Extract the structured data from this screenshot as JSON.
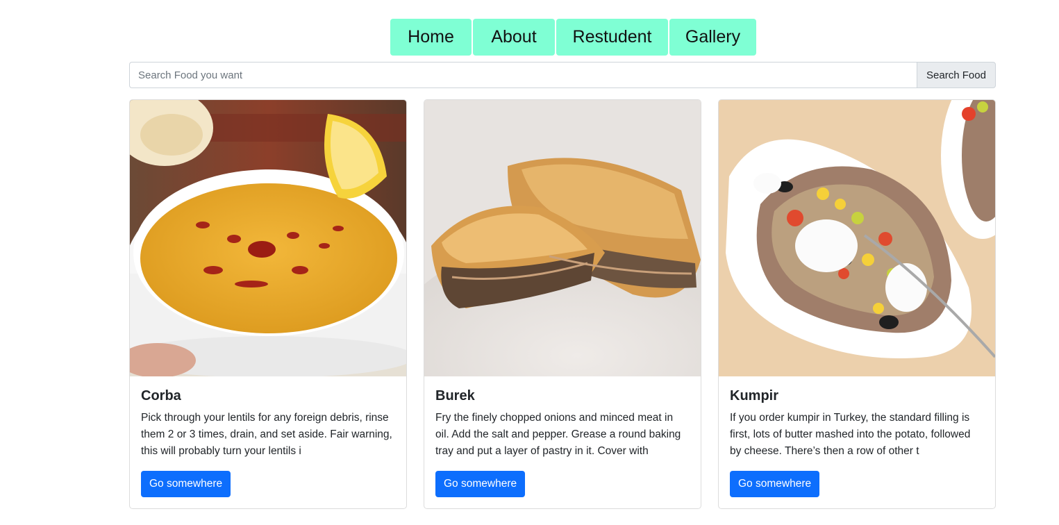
{
  "nav": {
    "items": [
      {
        "label": "Home"
      },
      {
        "label": "About"
      },
      {
        "label": "Restudent"
      },
      {
        "label": "Gallery"
      }
    ],
    "color": "#7fffd4"
  },
  "search": {
    "placeholder": "Search Food you want",
    "value": "",
    "button_label": "Search Food"
  },
  "cards": [
    {
      "image": "lentil-soup-photo",
      "title": "Corba",
      "text": "Pick through your lentils for any foreign debris, rinse them 2 or 3 times, drain, and set aside. Fair warning, this will probably turn your lentils i",
      "button_label": "Go somewhere"
    },
    {
      "image": "burek-pastry-photo",
      "title": "Burek",
      "text": "Fry the finely chopped onions and minced meat in oil. Add the salt and pepper. Grease a round baking tray and put a layer of pastry in it. Cover with",
      "button_label": "Go somewhere"
    },
    {
      "image": "kumpir-potato-photo",
      "title": "Kumpir",
      "text": "If you order kumpir in Turkey, the standard filling is first, lots of butter mashed into the potato, followed by cheese. There’s then a row of other t",
      "button_label": "Go somewhere"
    }
  ],
  "colors": {
    "primary_button": "#0d6efd",
    "nav_bg": "#7fffd4"
  }
}
